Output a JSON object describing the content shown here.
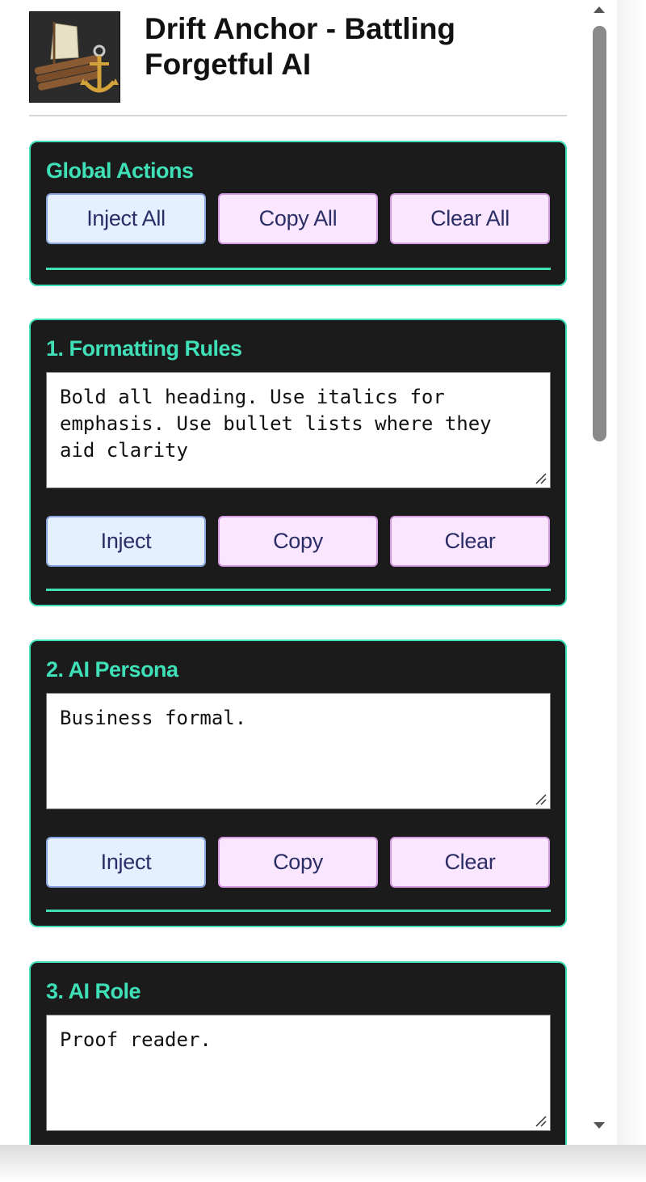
{
  "header": {
    "title": "Drift Anchor - Battling\nForgetful AI",
    "logo_icon": "raft-anchor-logo"
  },
  "global_actions": {
    "title": "Global Actions",
    "inject_label": "Inject All",
    "copy_label": "Copy All",
    "clear_label": "Clear All"
  },
  "sections": [
    {
      "title": "1. Formatting Rules",
      "value": "Bold all heading. Use italics for emphasis. Use bullet lists where they aid clarity",
      "inject_label": "Inject",
      "copy_label": "Copy",
      "clear_label": "Clear"
    },
    {
      "title": "2. AI Persona",
      "value": "Business formal.",
      "inject_label": "Inject",
      "copy_label": "Copy",
      "clear_label": "Clear"
    },
    {
      "title": "3. AI Role",
      "value": "Proof reader."
    }
  ],
  "colors": {
    "accent": "#3fe0b8",
    "panel_bg": "#1b1b1b",
    "inject_bg": "#e4efff",
    "copy_clear_bg": "#fbe6ff",
    "button_text": "#2b2d66"
  }
}
